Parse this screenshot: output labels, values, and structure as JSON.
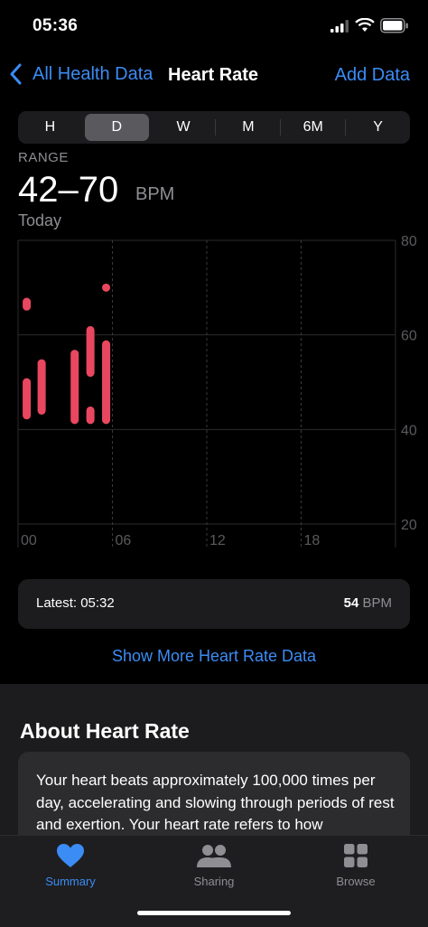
{
  "status": {
    "time": "05:36"
  },
  "nav": {
    "back_label": "All Health Data",
    "title": "Heart Rate",
    "add_label": "Add Data"
  },
  "segments": [
    "H",
    "D",
    "W",
    "M",
    "6M",
    "Y"
  ],
  "selected_segment": "D",
  "range": {
    "label": "RANGE",
    "value": "42–70",
    "unit": "BPM",
    "date": "Today"
  },
  "chart_data": {
    "type": "range-bar",
    "x_ticks": [
      "00",
      "06",
      "12",
      "18"
    ],
    "y_ticks": [
      80,
      60,
      40,
      20
    ],
    "xlim": [
      0,
      24
    ],
    "ylim": [
      20,
      80
    ],
    "bar_color": "#e8475f",
    "points": [
      {
        "x": 0.55,
        "low": 66,
        "high": 67
      },
      {
        "x": 0.55,
        "low": 43,
        "high": 50
      },
      {
        "x": 1.5,
        "low": 44,
        "high": 54
      },
      {
        "x": 3.6,
        "low": 42,
        "high": 56
      },
      {
        "x": 4.6,
        "low": 52,
        "high": 61
      },
      {
        "x": 4.6,
        "low": 42,
        "high": 44
      },
      {
        "x": 5.6,
        "low": 70,
        "high": 70
      },
      {
        "x": 5.6,
        "low": 42,
        "high": 58
      }
    ]
  },
  "latest": {
    "label": "Latest: 05:32",
    "value": "54",
    "unit": "BPM"
  },
  "more_link": "Show More Heart Rate Data",
  "about": {
    "title": "About Heart Rate",
    "text": "Your heart beats approximately 100,000 times per day, accelerating and slowing through periods of rest and exertion. Your heart rate refers to how"
  },
  "tabs": [
    {
      "label": "Summary",
      "icon": "heart-icon",
      "active": true
    },
    {
      "label": "Sharing",
      "icon": "people-icon",
      "active": false
    },
    {
      "label": "Browse",
      "icon": "grid-icon",
      "active": false
    }
  ],
  "colors": {
    "accent": "#3b8cf5",
    "heart": "#e8475f",
    "background": "#000000",
    "card": "#1c1c1e"
  }
}
